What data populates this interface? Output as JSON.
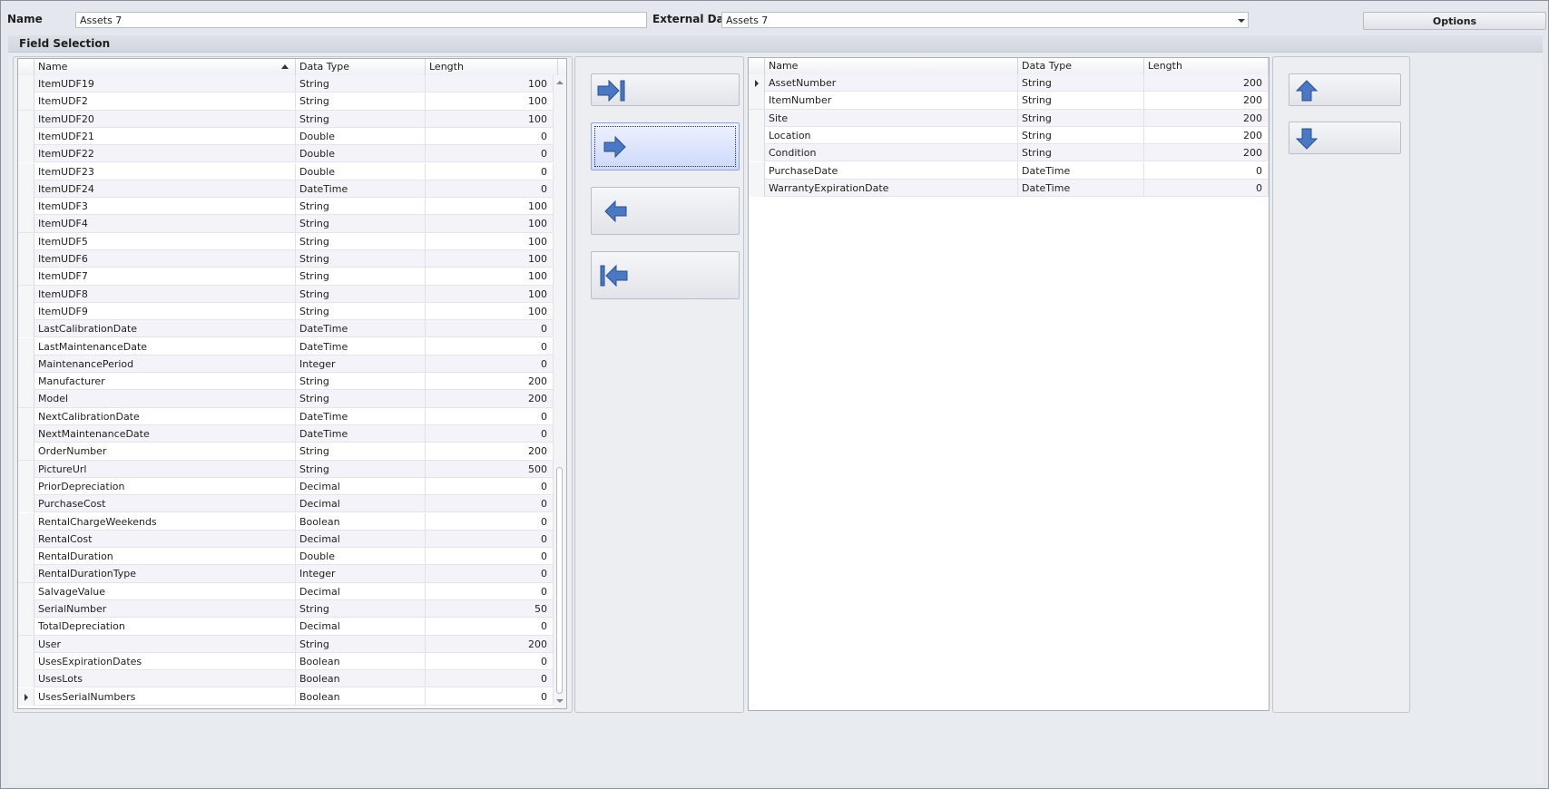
{
  "header": {
    "name_label": "Name",
    "name_value": "Assets 7",
    "external_label": "External Data",
    "external_value": "Assets 7",
    "options_label": "Options"
  },
  "group": {
    "title": "Field Selection"
  },
  "available": {
    "columns": [
      "Name",
      "Data Type",
      "Length"
    ],
    "sorted_column": "Name",
    "current_row": "UsesSerialNumbers",
    "rows": [
      [
        "ItemUDF19",
        "String",
        "100"
      ],
      [
        "ItemUDF2",
        "String",
        "100"
      ],
      [
        "ItemUDF20",
        "String",
        "100"
      ],
      [
        "ItemUDF21",
        "Double",
        "0"
      ],
      [
        "ItemUDF22",
        "Double",
        "0"
      ],
      [
        "ItemUDF23",
        "Double",
        "0"
      ],
      [
        "ItemUDF24",
        "DateTime",
        "0"
      ],
      [
        "ItemUDF3",
        "String",
        "100"
      ],
      [
        "ItemUDF4",
        "String",
        "100"
      ],
      [
        "ItemUDF5",
        "String",
        "100"
      ],
      [
        "ItemUDF6",
        "String",
        "100"
      ],
      [
        "ItemUDF7",
        "String",
        "100"
      ],
      [
        "ItemUDF8",
        "String",
        "100"
      ],
      [
        "ItemUDF9",
        "String",
        "100"
      ],
      [
        "LastCalibrationDate",
        "DateTime",
        "0"
      ],
      [
        "LastMaintenanceDate",
        "DateTime",
        "0"
      ],
      [
        "MaintenancePeriod",
        "Integer",
        "0"
      ],
      [
        "Manufacturer",
        "String",
        "200"
      ],
      [
        "Model",
        "String",
        "200"
      ],
      [
        "NextCalibrationDate",
        "DateTime",
        "0"
      ],
      [
        "NextMaintenanceDate",
        "DateTime",
        "0"
      ],
      [
        "OrderNumber",
        "String",
        "200"
      ],
      [
        "PictureUrl",
        "String",
        "500"
      ],
      [
        "PriorDepreciation",
        "Decimal",
        "0"
      ],
      [
        "PurchaseCost",
        "Decimal",
        "0"
      ],
      [
        "RentalChargeWeekends",
        "Boolean",
        "0"
      ],
      [
        "RentalCost",
        "Decimal",
        "0"
      ],
      [
        "RentalDuration",
        "Double",
        "0"
      ],
      [
        "RentalDurationType",
        "Integer",
        "0"
      ],
      [
        "SalvageValue",
        "Decimal",
        "0"
      ],
      [
        "SerialNumber",
        "String",
        "50"
      ],
      [
        "TotalDepreciation",
        "Decimal",
        "0"
      ],
      [
        "User",
        "String",
        "200"
      ],
      [
        "UsesExpirationDates",
        "Boolean",
        "0"
      ],
      [
        "UsesLots",
        "Boolean",
        "0"
      ],
      [
        "UsesSerialNumbers",
        "Boolean",
        "0"
      ]
    ]
  },
  "selected": {
    "columns": [
      "Name",
      "Data Type",
      "Length"
    ],
    "current_row": "AssetNumber",
    "rows": [
      [
        "AssetNumber",
        "String",
        "200"
      ],
      [
        "ItemNumber",
        "String",
        "200"
      ],
      [
        "Site",
        "String",
        "200"
      ],
      [
        "Location",
        "String",
        "200"
      ],
      [
        "Condition",
        "String",
        "200"
      ],
      [
        "PurchaseDate",
        "DateTime",
        "0"
      ],
      [
        "WarrantyExpirationDate",
        "DateTime",
        "0"
      ]
    ]
  },
  "transfer_buttons": [
    {
      "name": "add-all-button",
      "icon": "arrow-right-bar-icon"
    },
    {
      "name": "add-button",
      "icon": "arrow-right-icon",
      "focused": true
    },
    {
      "name": "remove-button",
      "icon": "arrow-left-icon"
    },
    {
      "name": "remove-all-button",
      "icon": "arrow-left-bar-icon"
    }
  ],
  "order_buttons": [
    {
      "name": "move-up-button",
      "icon": "arrow-up-icon"
    },
    {
      "name": "move-down-button",
      "icon": "arrow-down-icon"
    }
  ],
  "colors": {
    "arrow_fill": "#4a78c2",
    "arrow_stroke": "#2c4f8c",
    "focused_button": "#cdd9fb"
  }
}
